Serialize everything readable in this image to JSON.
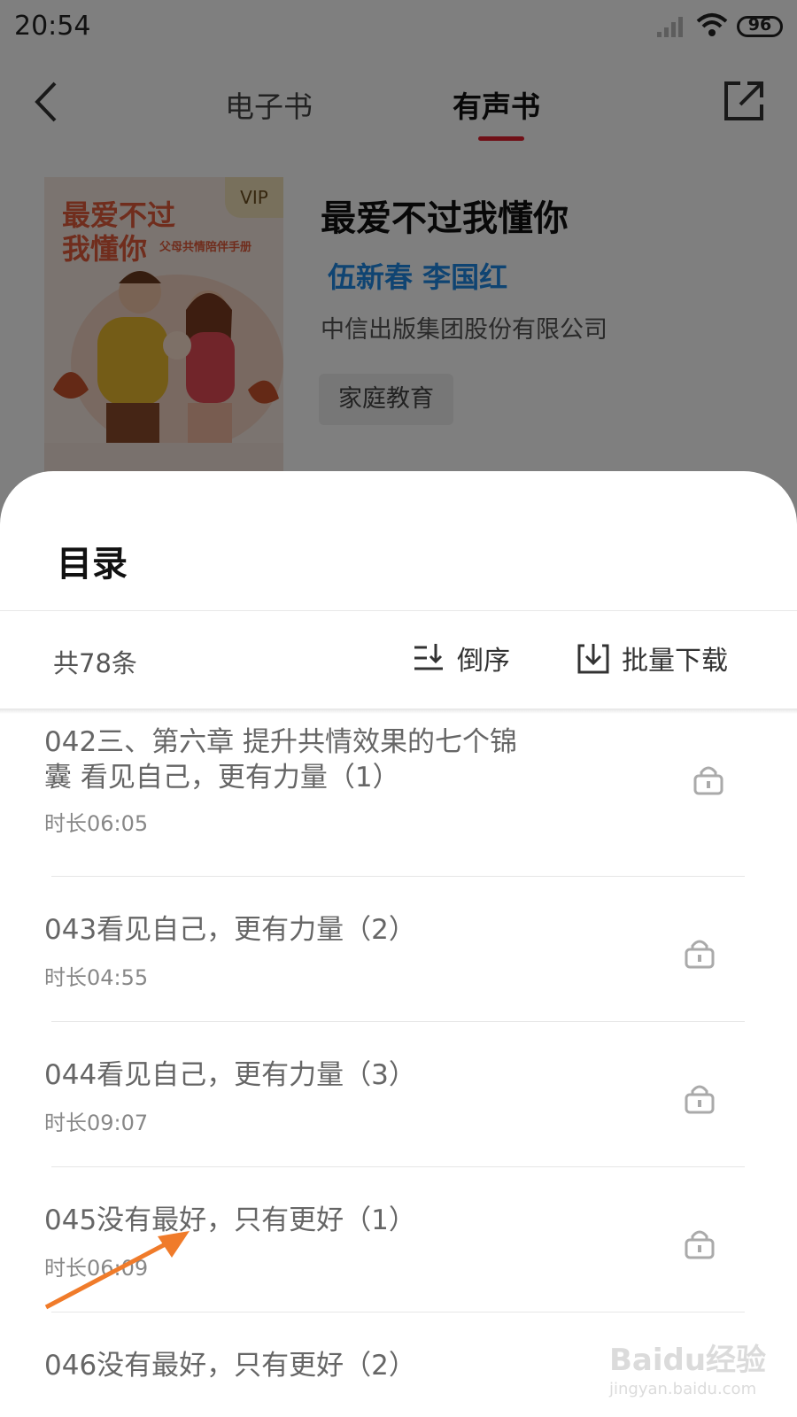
{
  "status_bar": {
    "time": "20:54",
    "battery": "96"
  },
  "nav": {
    "tabs": [
      {
        "label": "电子书"
      },
      {
        "label": "有声书"
      }
    ],
    "active_tab": "有声书",
    "accent": "#e0202e"
  },
  "book": {
    "title": "最爱不过我懂你",
    "authors": "伍新春 李国红",
    "publisher": "中信出版集团股份有限公司",
    "tag": "家庭教育",
    "cover": {
      "title_line1": "最爱不过",
      "title_line2": "我懂你",
      "subtitle": "父母共情陪伴手册",
      "vip_badge": "VIP"
    }
  },
  "catalog": {
    "title": "目录",
    "count": "共78条",
    "sort_label": "倒序",
    "download_label": "批量下载",
    "chapters": [
      {
        "title": "042三、第六章 提升共情效果的七个锦囊 看见自己，更有力量（1）",
        "duration": "时长06:05"
      },
      {
        "title": "043看见自己，更有力量（2）",
        "duration": "时长04:55"
      },
      {
        "title": "044看见自己，更有力量（3）",
        "duration": "时长09:07"
      },
      {
        "title": "045没有最好，只有更好（1）",
        "duration": "时长06:09"
      },
      {
        "title": "046没有最好，只有更好（2）",
        "duration": ""
      }
    ]
  },
  "watermark": {
    "text": "Baidu经验",
    "url": "jingyan.baidu.com"
  },
  "colors": {
    "author_blue": "#1e88e5",
    "arrow_orange": "#f07b2a"
  }
}
